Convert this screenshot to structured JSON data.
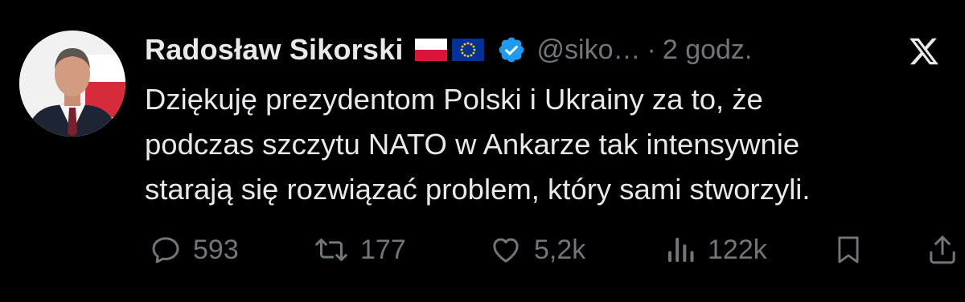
{
  "author": {
    "name": "Radosław Sikorski",
    "handle": "@siko…",
    "separator": "·",
    "time": "2 godz."
  },
  "tweet": {
    "lines": [
      "Dziękuję prezydentom Polski i Ukrainy za to, że",
      "podczas szczytu NATO w Ankarze tak intensywnie",
      "starają się rozwiązać problem, który sami stworzyli."
    ]
  },
  "actions": {
    "replies": "593",
    "retweets": "177",
    "likes": "5,2k",
    "views": "122k"
  },
  "icons": {
    "verified": "verified-badge-icon",
    "flags": [
      "poland-flag-icon",
      "eu-flag-icon"
    ],
    "logo": "x-logo-icon",
    "reply": "reply-icon",
    "retweet": "retweet-icon",
    "like": "heart-icon",
    "views": "views-icon",
    "bookmark": "bookmark-icon",
    "share": "share-icon"
  },
  "colors": {
    "background": "#000000",
    "text": "#e7e9ea",
    "muted": "#71767b",
    "verified": "#1d9bf0"
  }
}
